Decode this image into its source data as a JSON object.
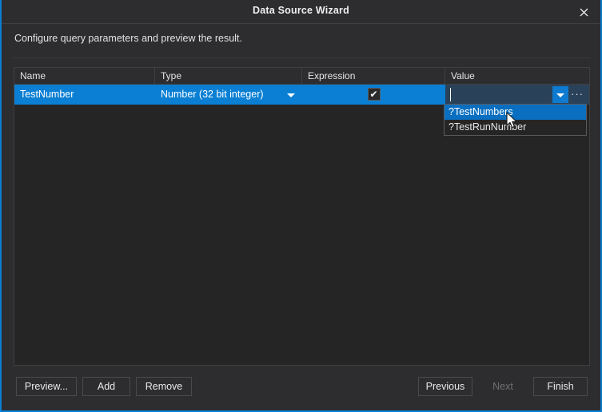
{
  "window": {
    "title": "Data Source Wizard",
    "close_icon": "close-icon",
    "accent_color": "#0a7fd4",
    "background_color": "#2d2d30"
  },
  "description": "Configure query parameters and preview the result.",
  "grid": {
    "columns": [
      "Name",
      "Type",
      "Expression",
      "Value"
    ],
    "rows": [
      {
        "name": "TestNumber",
        "type": "Number (32 bit integer)",
        "type_dropdown_icon": "chevron-down-icon",
        "expression_checked": "✔",
        "value": "",
        "value_dropdown_icon": "chevron-down-icon",
        "value_ellipsis_icon": "···",
        "value_add_icon": "+",
        "selected": true
      }
    ]
  },
  "autocomplete": {
    "items": [
      {
        "label": "?TestNumbers",
        "selected": true
      },
      {
        "label": "?TestRunNumber",
        "selected": false
      }
    ]
  },
  "footer": {
    "preview_label": "Preview...",
    "add_label": "Add",
    "remove_label": "Remove",
    "previous_label": "Previous",
    "next_label": "Next",
    "finish_label": "Finish"
  }
}
